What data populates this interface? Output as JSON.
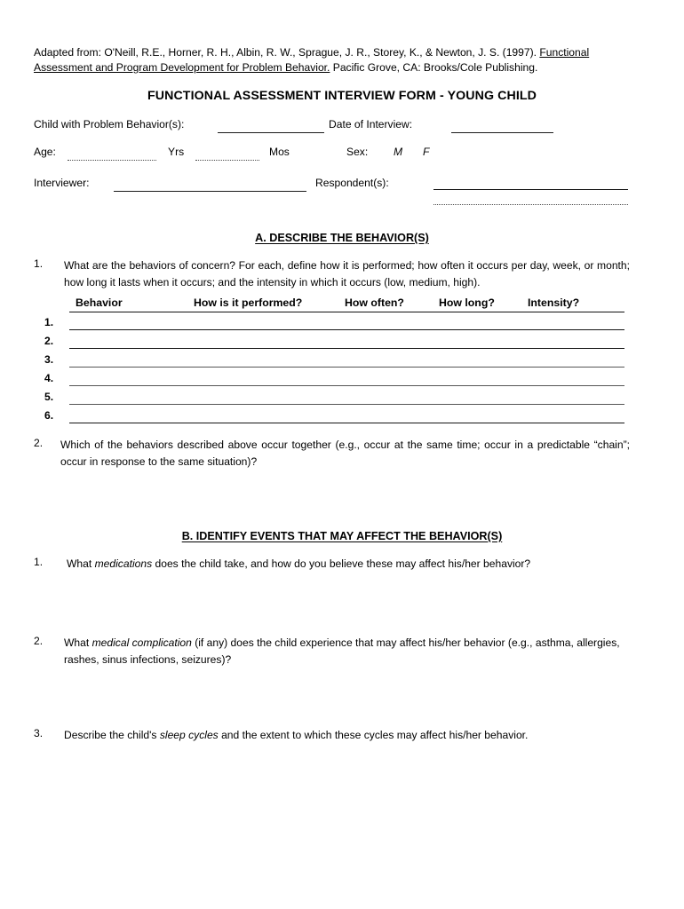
{
  "document": {
    "citation_prefix": "Adapted from: O'Neill, R.E., Horner, R. H., Albin, R. W., Sprague, J. R., Storey, K., & Newton, J. S. (1997).  ",
    "citation_title": "Functional Assessment and Program Development for Problem Behavior.",
    "citation_suffix": "  Pacific Grove, CA: Brooks/Cole Publishing.",
    "title": "FUNCTIONAL ASSESSMENT INTERVIEW FORM - YOUNG CHILD"
  },
  "form_fields": {
    "child_label": "Child with Problem Behavior(s):",
    "child_value": "",
    "date_label": "Date of Interview:",
    "date_value": "",
    "age_label": "Age:",
    "age_years_value": "",
    "years_label": "Yrs",
    "age_months_value": "",
    "months_label": "Mos",
    "sex_label": "Sex:",
    "sex_male": "M",
    "sex_female": "F",
    "interviewer_label": "Interviewer:",
    "interviewer_value": "",
    "respondents_label": "Respondent(s):",
    "respondents_value": "",
    "respondents_value_2": ""
  },
  "section_a": {
    "heading": "A.  DESCRIBE THE BEHAVIOR(S)",
    "q1_number": "1.",
    "q1_text": "What are the behaviors of concern?  For each, define how it is performed; how often it occurs per day, week, or month; how long it lasts when it occurs; and the intensity in which it occurs (low, medium, high).",
    "table": {
      "columns": [
        "Behavior",
        "How is it performed?",
        "How often?",
        "How long?",
        "Intensity?"
      ],
      "row_numbers": [
        "1.",
        "2.",
        "3.",
        "4.",
        "5.",
        "6."
      ],
      "rows": [
        {
          "behavior": "",
          "how_performed": "",
          "how_often": "",
          "how_long": "",
          "intensity": ""
        },
        {
          "behavior": "",
          "how_performed": "",
          "how_often": "",
          "how_long": "",
          "intensity": ""
        },
        {
          "behavior": "",
          "how_performed": "",
          "how_often": "",
          "how_long": "",
          "intensity": ""
        },
        {
          "behavior": "",
          "how_performed": "",
          "how_often": "",
          "how_long": "",
          "intensity": ""
        },
        {
          "behavior": "",
          "how_performed": "",
          "how_often": "",
          "how_long": "",
          "intensity": ""
        },
        {
          "behavior": "",
          "how_performed": "",
          "how_often": "",
          "how_long": "",
          "intensity": ""
        }
      ]
    },
    "q2_number": "2.",
    "q2_text": "Which of the behaviors described above occur together (e.g., occur at the same time; occur in a predictable “chain”; occur in response to the same situation)?",
    "q2_answer": ""
  },
  "section_b": {
    "heading": "B.  IDENTIFY EVENTS THAT MAY AFFECT THE BEHAVIOR(S)",
    "q1_number": "1.",
    "q1_part1": "What ",
    "q1_emphasis": "medications",
    "q1_part2": " does the child take, and how do you believe these may affect his/her behavior?",
    "q1_answer": "",
    "q2_number": "2.",
    "q2_part1": "What ",
    "q2_emphasis": "medical complication",
    "q2_part2": " (if any) does the child experience that may affect his/her behavior (e.g., asthma, allergies, rashes, sinus infections, seizures)?",
    "q2_answer": "",
    "q3_number": "3.",
    "q3_part1": "Describe the child's ",
    "q3_emphasis": "sleep cycles",
    "q3_part2": " and the extent to which these cycles may affect his/her behavior.",
    "q3_answer": ""
  }
}
